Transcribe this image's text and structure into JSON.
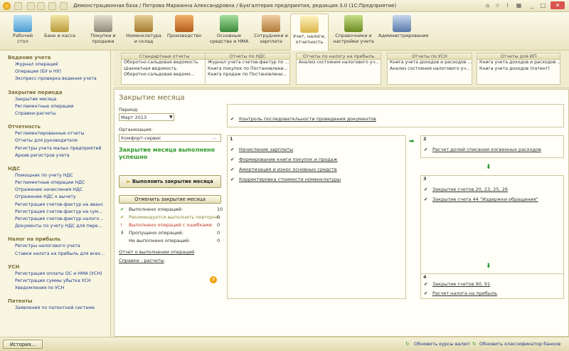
{
  "window": {
    "title": "Демонстрационная база / Петрова Марианна Александровна / Бухгалтерия предприятия, редакция 3.0  (1С:Предприятие)"
  },
  "toolbar": [
    {
      "label": "Рабочий стол",
      "icon": "desktop-icon"
    },
    {
      "label": "Банк и касса",
      "icon": "bank-icon"
    },
    {
      "label": "Покупки и продажи",
      "icon": "truck-icon"
    },
    {
      "label": "Номенклатура и склад",
      "icon": "warehouse-icon"
    },
    {
      "label": "Производство",
      "icon": "tools-icon"
    },
    {
      "label": "Основные средства и НМА",
      "icon": "assets-icon"
    },
    {
      "label": "Сотрудники и зарплата",
      "icon": "people-icon"
    },
    {
      "label": "Учет, налоги, отчетность",
      "icon": "ledger-icon"
    },
    {
      "label": "Справочники и настройки учета",
      "icon": "books-icon"
    },
    {
      "label": "Администрирование",
      "icon": "admin-icon"
    }
  ],
  "sidebar": [
    {
      "header": "Ведение учета",
      "items": [
        "Журнал операций",
        "Операции (БУ и НУ)",
        "Экспресс-проверка ведения учета"
      ]
    },
    {
      "header": "Закрытие периода",
      "items": [
        "Закрытие месяца",
        "Регламентные операции",
        "Справки-расчеты"
      ]
    },
    {
      "header": "Отчетность",
      "items": [
        "Регламентированные отчеты",
        "Отчеты для руководителя",
        "Регистры учета малых предприятий",
        "Архив регистров учета"
      ]
    },
    {
      "header": "НДС",
      "items": [
        "Помощник по учету НДС",
        "Регламентные операции НДС",
        "Отражение начисления НДС",
        "Отражение НДС к вычету",
        "Регистрация счетов-фактур на аванс",
        "Регистрация счетов-фактур на сум...",
        "Регистрация счетов-фактур налого...",
        "Документы по учету НДС для пере..."
      ]
    },
    {
      "header": "Налог на прибыль",
      "items": [
        "Регистры налогового учета",
        "Ставки налога на прибыль для всех..."
      ]
    },
    {
      "header": "УСН",
      "items": [
        "Регистрация оплаты ОС и НМА (УСН)",
        "Регистрация суммы убытка УСН",
        "Уведомления по УСН"
      ]
    },
    {
      "header": "Патенты",
      "items": [
        "Заявления по патентной системе"
      ]
    }
  ],
  "reports": [
    {
      "header": "Стандартные отчеты",
      "items": [
        "Оборотно-сальдовая ведомость",
        "Шахматная ведомость",
        "Оборотно-сальдовая ведомо..."
      ]
    },
    {
      "header": "Отчеты по НДС",
      "items": [
        "Журнал учета счетов-фактур по ...",
        "Книга покупок по Постановлени...",
        "Книга продаж по Постановлени..."
      ]
    },
    {
      "header": "Отчеты по налогу на прибыль",
      "items": [
        "Анализ состояния налогового уч..."
      ]
    },
    {
      "header": "Отчеты по УСН",
      "items": [
        "Книга учета доходов и расходов ...",
        "Анализ состояния налогового уч..."
      ]
    },
    {
      "header": "Отчеты для ИП",
      "items": [
        "Книга учета доходов и расходов ...",
        "Книга учета доходов (патент)"
      ]
    }
  ],
  "closing": {
    "title": "Закрытие месяца",
    "period_label": "Период:",
    "period_value": "Март 2013",
    "org_label": "Организация:",
    "org_value": "Комфорт-сервис",
    "done_text": "Закрытие месяца выполнено успешно",
    "run_button": "Выполнить закрытие месяца",
    "cancel_button": "Отменить закрытие месяца",
    "stats": [
      {
        "label": "Выполнено операций:",
        "value": "10",
        "color": "#2e9a2e"
      },
      {
        "label": "Рекомендуется выполнить повторно:",
        "value": "0",
        "color": "#8a8a3a"
      },
      {
        "label": "Выполнено операций с ошибками:",
        "value": "0",
        "color": "#c0392b"
      },
      {
        "label": "Пропущено операций:",
        "value": "0",
        "color": "#333333"
      },
      {
        "label": "Не выполнено операций:",
        "value": "0",
        "color": "#333333"
      }
    ],
    "report_link": "Отчет о выполнении операций",
    "calc_link": "Справки - расчеты",
    "help": "?"
  },
  "steps": {
    "top_link": "Контроль последовательности проведения документов",
    "step1": {
      "num": "1",
      "items": [
        "Начисление зарплаты",
        "Формирование книги покупок и продаж",
        "Амортизация и износ основных средств",
        "Корректировка стоимости номенклатуры"
      ]
    },
    "step2": {
      "num": "2",
      "items": [
        "Расчет долей списания косвенных расходов"
      ]
    },
    "step3": {
      "num": "3",
      "items": [
        "Закрытие счетов 20, 23, 25, 26",
        "Закрытие счета 44 \"Издержки обращения\""
      ]
    },
    "step4": {
      "num": "4",
      "items": [
        "Закрытие счетов 90, 91",
        "Расчет налога на прибыль"
      ]
    }
  },
  "status": {
    "history_button": "История...",
    "update_rates": "Обновить курсы валют",
    "update_banks": "Обновить классификатор банков"
  },
  "colors": {
    "accent": "#2e9a2e",
    "link": "#1c3a8a",
    "bg": "#f5f2da"
  }
}
